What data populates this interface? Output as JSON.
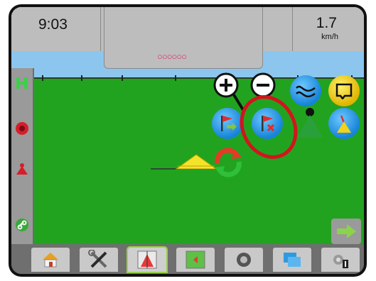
{
  "status": {
    "time": "9:03",
    "speed": "1.7",
    "speed_unit": "km/h"
  },
  "center_indicator": "○○○○○○",
  "colors": {
    "sky": "#8cc6ee",
    "ground": "#22a31f",
    "panel": "#bdbdbd",
    "button_blue": "#1683d8",
    "button_yellow": "#e0b400",
    "highlight_ring": "#d1151d",
    "active_tab_outline": "#9ad04a"
  },
  "map_buttons": [
    {
      "name": "zoom-in-button",
      "icon": "plus-magnifier-icon"
    },
    {
      "name": "zoom-out-button",
      "icon": "minus-magnifier-icon"
    },
    {
      "name": "guidance-line-button",
      "icon": "curve-line-icon"
    },
    {
      "name": "boundary-button",
      "icon": "boundary-icon"
    },
    {
      "name": "mark-a-button",
      "icon": "flag-arrow-icon"
    },
    {
      "name": "cancel-mark-button",
      "icon": "flag-x-icon"
    },
    {
      "name": "perspective-view-button",
      "icon": "vehicle-perspective-icon"
    },
    {
      "name": "overhead-view-button",
      "icon": "vehicle-overhead-icon"
    }
  ],
  "sidebar_items": [
    "auto-steer-icon",
    "warning-icon",
    "vehicle-icon",
    "link-icon"
  ],
  "bottom_tabs": [
    {
      "name": "home",
      "icon": "home-icon"
    },
    {
      "name": "setup",
      "icon": "tools-icon"
    },
    {
      "name": "guidance",
      "icon": "guidance-icon",
      "active": true
    },
    {
      "name": "mapping",
      "icon": "map-icon"
    },
    {
      "name": "camera",
      "icon": "camera-icon"
    },
    {
      "name": "data",
      "icon": "data-icon"
    },
    {
      "name": "unit-1",
      "icon": "gear-one-icon"
    }
  ]
}
